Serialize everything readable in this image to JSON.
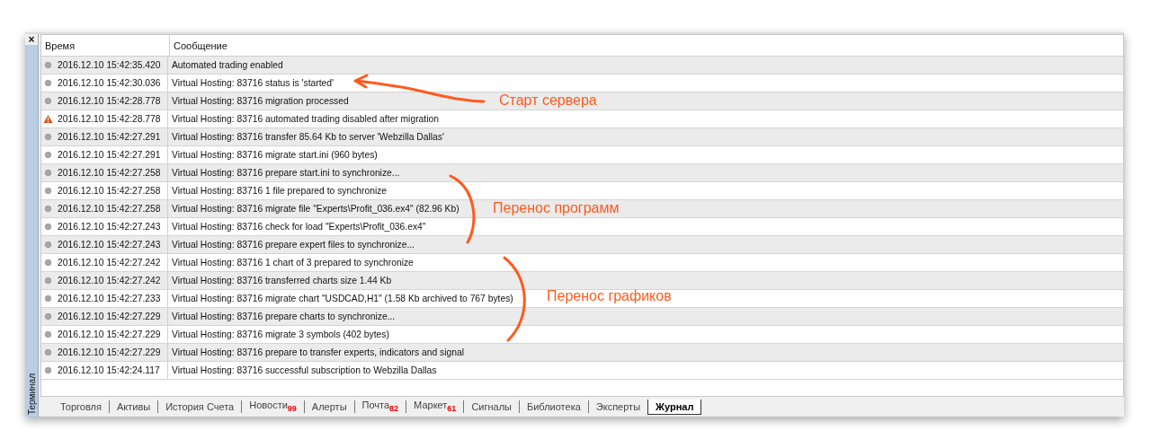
{
  "panel": {
    "close": "×",
    "side_label": "Терминал"
  },
  "table": {
    "columns": [
      "Время",
      "Сообщение"
    ],
    "rows": [
      {
        "kind": "info",
        "time": "2016.12.10 15:42:35.420",
        "message": "Automated trading enabled"
      },
      {
        "kind": "info",
        "time": "2016.12.10 15:42:30.036",
        "message": "Virtual Hosting: 83716 status is 'started'"
      },
      {
        "kind": "info",
        "time": "2016.12.10 15:42:28.778",
        "message": "Virtual Hosting: 83716 migration processed"
      },
      {
        "kind": "warning",
        "time": "2016.12.10 15:42:28.778",
        "message": "Virtual Hosting: 83716 automated trading disabled after migration"
      },
      {
        "kind": "info",
        "time": "2016.12.10 15:42:27.291",
        "message": "Virtual Hosting: 83716 transfer 85.64 Kb to server 'Webzilla Dallas'"
      },
      {
        "kind": "info",
        "time": "2016.12.10 15:42:27.291",
        "message": "Virtual Hosting: 83716 migrate start.ini (960 bytes)"
      },
      {
        "kind": "info",
        "time": "2016.12.10 15:42:27.258",
        "message": "Virtual Hosting: 83716 prepare start.ini to synchronize..."
      },
      {
        "kind": "info",
        "time": "2016.12.10 15:42:27.258",
        "message": "Virtual Hosting: 83716 1 file prepared to synchronize"
      },
      {
        "kind": "info",
        "time": "2016.12.10 15:42:27.258",
        "message": "Virtual Hosting: 83716 migrate file \"Experts\\Profit_036.ex4\" (82.96 Kb)"
      },
      {
        "kind": "info",
        "time": "2016.12.10 15:42:27.243",
        "message": "Virtual Hosting: 83716 check for load \"Experts\\Profit_036.ex4\""
      },
      {
        "kind": "info",
        "time": "2016.12.10 15:42:27.243",
        "message": "Virtual Hosting: 83716 prepare expert files to synchronize..."
      },
      {
        "kind": "info",
        "time": "2016.12.10 15:42:27.242",
        "message": "Virtual Hosting: 83716 1 chart of 3 prepared to synchronize"
      },
      {
        "kind": "info",
        "time": "2016.12.10 15:42:27.242",
        "message": "Virtual Hosting: 83716 transferred charts size 1.44 Kb"
      },
      {
        "kind": "info",
        "time": "2016.12.10 15:42:27.233",
        "message": "Virtual Hosting: 83716 migrate chart \"USDCAD,H1\" (1.58 Kb archived to 767 bytes)"
      },
      {
        "kind": "info",
        "time": "2016.12.10 15:42:27.229",
        "message": "Virtual Hosting: 83716 prepare charts to synchronize..."
      },
      {
        "kind": "info",
        "time": "2016.12.10 15:42:27.229",
        "message": "Virtual Hosting: 83716 migrate 3 symbols (402 bytes)"
      },
      {
        "kind": "info",
        "time": "2016.12.10 15:42:27.229",
        "message": "Virtual Hosting: 83716 prepare to transfer experts, indicators and signal"
      },
      {
        "kind": "info",
        "time": "2016.12.10 15:42:24.117",
        "message": "Virtual Hosting: 83716 successful subscription to Webzilla Dallas"
      }
    ]
  },
  "tabs": [
    {
      "label": "Торговля",
      "selected": false
    },
    {
      "label": "Активы",
      "selected": false
    },
    {
      "label": "История Счета",
      "selected": false
    },
    {
      "label": "Новости",
      "badge": "99",
      "selected": false
    },
    {
      "label": "Алерты",
      "selected": false
    },
    {
      "label": "Почта",
      "badge": "82",
      "selected": false
    },
    {
      "label": "Маркет",
      "badge": "61",
      "selected": false
    },
    {
      "label": "Сигналы",
      "selected": false
    },
    {
      "label": "Библиотека",
      "selected": false
    },
    {
      "label": "Эксперты",
      "selected": false
    },
    {
      "label": "Журнал",
      "selected": true
    }
  ],
  "annotations": [
    "Старт сервера",
    "Перенос программ",
    "Перенос графиков"
  ]
}
